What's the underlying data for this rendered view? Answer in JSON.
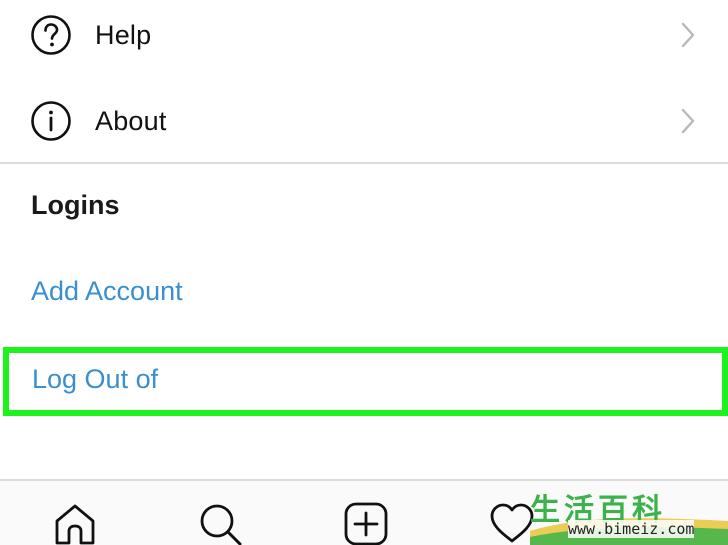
{
  "menu": {
    "items": [
      {
        "label": "Help",
        "icon": "question-circle-icon"
      },
      {
        "label": "About",
        "icon": "info-circle-icon"
      }
    ]
  },
  "logins": {
    "heading": "Logins",
    "add_account": "Add Account",
    "log_out": "Log Out of"
  },
  "tab_bar": {
    "tabs": [
      "home-icon",
      "search-icon",
      "add-post-icon",
      "heart-icon"
    ]
  },
  "watermark": {
    "chinese": "生活百科",
    "url": "www.bimeiz.com"
  },
  "colors": {
    "link": "#3a8fd0",
    "highlight": "#1cf21c",
    "watermark_green": "#3cb34a"
  }
}
